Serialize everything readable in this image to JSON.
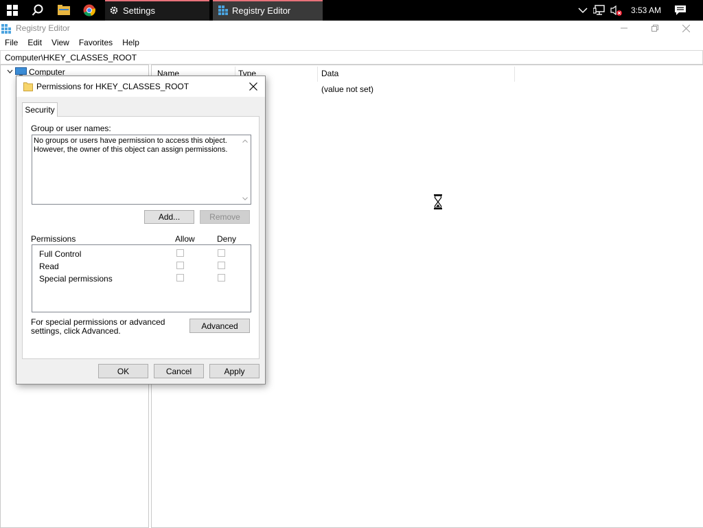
{
  "taskbar": {
    "icons": [
      "windows-start-icon",
      "search-icon",
      "file-explorer-icon",
      "chrome-icon"
    ],
    "apps": [
      {
        "label": "Settings",
        "icon": "gear-icon",
        "accent": "#e8727a"
      },
      {
        "label": "Registry Editor",
        "icon": "registry-editor-icon",
        "accent": "#e8727a"
      }
    ],
    "clock": "3:53 AM"
  },
  "window": {
    "title": "Registry Editor",
    "menu": [
      "File",
      "Edit",
      "View",
      "Favorites",
      "Help"
    ],
    "address": "Computer\\HKEY_CLASSES_ROOT",
    "tree_root": "Computer",
    "columns": [
      "Name",
      "Type",
      "Data"
    ],
    "rows": [
      {
        "data": "(value not set)"
      }
    ]
  },
  "dialog": {
    "title": "Permissions for HKEY_CLASSES_ROOT",
    "tab": "Security",
    "group_label": "Group or user names:",
    "group_message": "No groups or users have permission to access this object. However, the owner of this object can assign permissions.",
    "add_label": "Add...",
    "remove_label": "Remove",
    "permissions_label": "Permissions",
    "allow_label": "Allow",
    "deny_label": "Deny",
    "permissions": [
      {
        "name": "Full Control",
        "allow": false,
        "deny": false
      },
      {
        "name": "Read",
        "allow": false,
        "deny": false
      },
      {
        "name": "Special permissions",
        "allow": false,
        "deny": false
      }
    ],
    "advanced_text": "For special permissions or advanced settings, click Advanced.",
    "advanced_label": "Advanced",
    "ok_label": "OK",
    "cancel_label": "Cancel",
    "apply_label": "Apply"
  },
  "colors": {
    "taskbar_bg": "#000000",
    "dialog_bg": "#f0f0f0",
    "button_bg": "#e1e1e1",
    "active_app_accent": "#e8727a"
  }
}
